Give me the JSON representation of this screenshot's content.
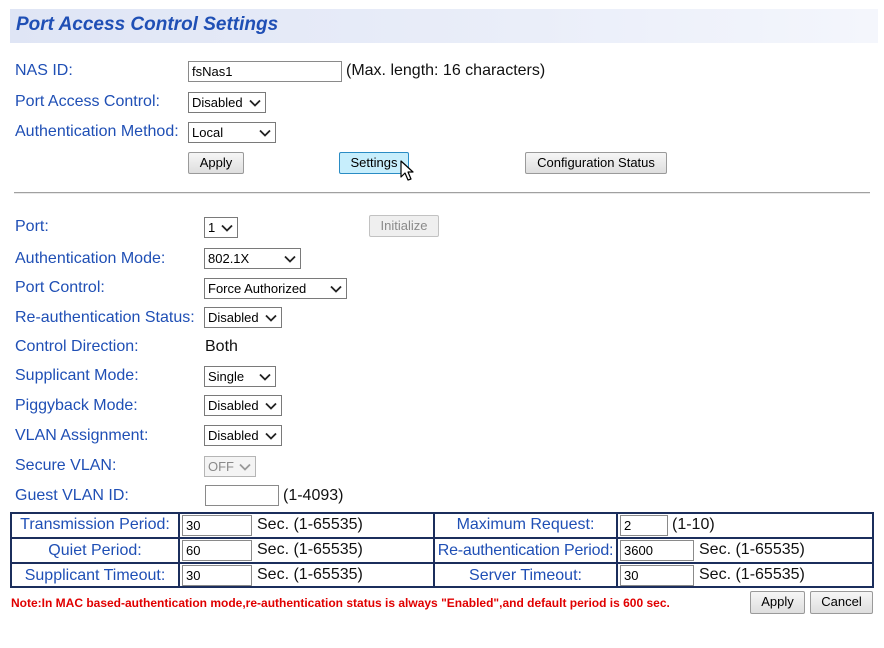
{
  "page": {
    "title": "Port Access Control Settings"
  },
  "global": {
    "nas_id": {
      "label": "NAS ID:",
      "value": "fsNas1",
      "hint": "(Max. length: 16 characters)"
    },
    "port_access_control": {
      "label": "Port Access Control:",
      "value": "Disabled"
    },
    "auth_method": {
      "label": "Authentication Method:",
      "value": "Local"
    },
    "apply_label": "Apply",
    "settings_label": "Settings",
    "config_status_label": "Configuration Status"
  },
  "port": {
    "port": {
      "label": "Port:",
      "value": "1"
    },
    "initialize_label": "Initialize",
    "auth_mode": {
      "label": "Authentication Mode:",
      "value": "802.1X"
    },
    "port_control": {
      "label": "Port Control:",
      "value": "Force Authorized"
    },
    "reauth_status": {
      "label": "Re-authentication Status:",
      "value": "Disabled"
    },
    "control_direction": {
      "label": "Control Direction:",
      "value": "Both"
    },
    "supplicant_mode": {
      "label": "Supplicant Mode:",
      "value": "Single"
    },
    "piggyback_mode": {
      "label": "Piggyback Mode:",
      "value": "Disabled"
    },
    "vlan_assignment": {
      "label": "VLAN Assignment:",
      "value": "Disabled"
    },
    "secure_vlan": {
      "label": "Secure VLAN:",
      "value": "OFF"
    },
    "guest_vlan": {
      "label": "Guest VLAN ID:",
      "value": "",
      "hint": "(1-4093)"
    }
  },
  "timers": {
    "transmission_period": {
      "label": "Transmission Period:",
      "value": "30",
      "unit": "Sec. (1-65535)"
    },
    "maximum_request": {
      "label": "Maximum Request:",
      "value": "2",
      "unit": "(1-10)"
    },
    "quiet_period": {
      "label": "Quiet Period:",
      "value": "60",
      "unit": "Sec. (1-65535)"
    },
    "reauth_period": {
      "label": "Re-authentication Period:",
      "value": "3600",
      "unit": "Sec. (1-65535)"
    },
    "supplicant_timeout": {
      "label": "Supplicant Timeout:",
      "value": "30",
      "unit": "Sec. (1-65535)"
    },
    "server_timeout": {
      "label": "Server Timeout:",
      "value": "30",
      "unit": "Sec. (1-65535)"
    }
  },
  "footer": {
    "note": "Note:In MAC based-authentication mode,re-authentication status is always \"Enabled\",and default period is 600 sec.",
    "apply_label": "Apply",
    "cancel_label": "Cancel"
  },
  "icons": {
    "dropdown": "chevron-down-icon",
    "cursor": "mouse-pointer-icon"
  }
}
